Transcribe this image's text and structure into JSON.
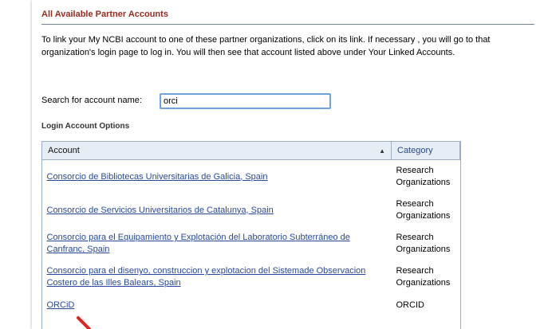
{
  "section": {
    "title": "All Available Partner Accounts",
    "intro": "To link your My NCBI account to one of these partner organizations, click on its link. If necessary , you will go to that organization's login page to log in. You will then see that account listed above under Your Linked Accounts."
  },
  "search": {
    "label": "Search for account name:",
    "value": "orci"
  },
  "options": {
    "title": "Login Account Options",
    "columns": [
      "Account",
      "Category"
    ],
    "rows": [
      {
        "account": "Consorcio de Bibliotecas Universitarias de Galicia, Spain",
        "category": "Research Organizations"
      },
      {
        "account": "Consorcio de Servicios Universitarios de Catalunya, Spain",
        "category": "Research Organizations"
      },
      {
        "account": "Consorcio para el Equipamiento y Explotación del Laboratorio Subterráneo de Canfranc, Spain",
        "category": "Research Organizations"
      },
      {
        "account": "Consorcio para el disenyo, construccion y explotacion del Sistemade Observacion Costero de las Illes Balears, Spain",
        "category": "Research Organizations"
      },
      {
        "account": "ORCiD",
        "category": "ORCID"
      }
    ]
  },
  "colors": {
    "title": "#9a2a1e",
    "link": "#27489c",
    "header_bg": "#e6edf5",
    "focus": "#6fa3e0",
    "annotation_arrow": "#e0231c"
  },
  "icons": {
    "sort": "sort-ascending-icon",
    "annotation": "red-arrow-icon"
  }
}
